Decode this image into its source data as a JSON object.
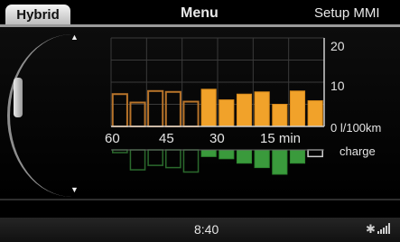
{
  "header": {
    "tab_hybrid": "Hybrid",
    "menu_label": "Menu",
    "setup_label": "Setup MMI"
  },
  "status_bar": {
    "time": "8:40",
    "icons": [
      "bluetooth-icon",
      "signal-strength-icon"
    ]
  },
  "colors": {
    "consumption_fill": "#f1a22a",
    "consumption_outline": "#b8742a",
    "charge_fill": "#3a9a3c",
    "charge_outline": "#2b6a2d",
    "grid": "#3a3a3a"
  },
  "chart_data": {
    "type": "bar",
    "x_ticks": [
      "60",
      "45",
      "30",
      "15 min"
    ],
    "y_ticks": [
      "20",
      "10",
      "0 l/100km"
    ],
    "lower_label": "charge",
    "ylim": [
      0,
      20
    ],
    "consumption": [
      7.3,
      5.4,
      8.0,
      7.8,
      5.6,
      8.4,
      6.0,
      7.3,
      7.8,
      5.0,
      8.0,
      5.8
    ],
    "consumption_filled": [
      false,
      false,
      false,
      false,
      false,
      true,
      true,
      true,
      true,
      true,
      true,
      true
    ],
    "charge": [
      0,
      -4.5,
      -3.5,
      -4.0,
      -5.0,
      -1.5,
      -2.0,
      -3.0,
      -4.0,
      -5.5,
      -3.0,
      -1.5
    ],
    "charge_filled": [
      false,
      false,
      false,
      false,
      false,
      true,
      true,
      true,
      true,
      true,
      true,
      false
    ]
  }
}
